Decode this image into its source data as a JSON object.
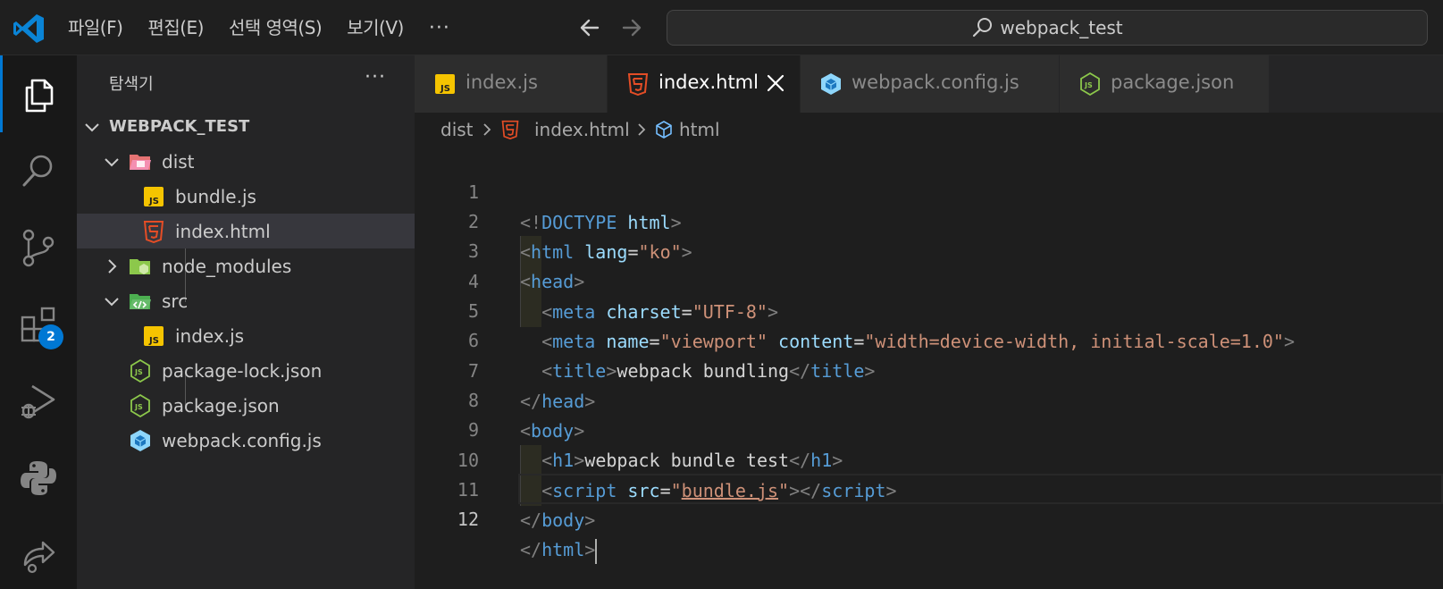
{
  "menu": {
    "items": [
      "파일(F)",
      "편집(E)",
      "선택 영역(S)",
      "보기(V)"
    ],
    "more": "···"
  },
  "search": {
    "text": "webpack_test"
  },
  "activity": {
    "extensions_badge": "2"
  },
  "sidebar": {
    "title": "탐색기",
    "more": "···",
    "root": "WEBPACK_TEST",
    "items": [
      {
        "label": "dist"
      },
      {
        "label": "bundle.js"
      },
      {
        "label": "index.html"
      },
      {
        "label": "node_modules"
      },
      {
        "label": "src"
      },
      {
        "label": "index.js"
      },
      {
        "label": "package-lock.json"
      },
      {
        "label": "package.json"
      },
      {
        "label": "webpack.config.js"
      }
    ]
  },
  "tabs": [
    {
      "label": "index.js"
    },
    {
      "label": "index.html"
    },
    {
      "label": "webpack.config.js"
    },
    {
      "label": "package.json"
    }
  ],
  "breadcrumb": {
    "folder": "dist",
    "file": "index.html",
    "symbol": "html"
  },
  "editor": {
    "line_numbers": [
      "1",
      "2",
      "3",
      "4",
      "5",
      "6",
      "7",
      "8",
      "9",
      "10",
      "11",
      "12"
    ],
    "code": {
      "l1": {
        "p1": "<!",
        "tag": "DOCTYPE",
        "attr": " html",
        "p2": ">"
      },
      "l2": {
        "p1": "<",
        "tag": "html",
        "attr": " lang",
        "eq": "=",
        "str": "\"ko\"",
        "p2": ">"
      },
      "l3": {
        "p1": "<",
        "tag": "head",
        "p2": ">"
      },
      "l4": {
        "p1": "<",
        "tag": "meta",
        "attr": " charset",
        "eq": "=",
        "str": "\"UTF-8\"",
        "p2": ">"
      },
      "l5": {
        "p1": "<",
        "tag": "meta",
        "attr1": " name",
        "eq1": "=",
        "str1": "\"viewport\"",
        "attr2": " content",
        "eq2": "=",
        "str2": "\"width=device-width, initial-scale=1.0\"",
        "p2": ">"
      },
      "l6": {
        "p1": "<",
        "tag": "title",
        "p2": ">",
        "text": "webpack bundling",
        "p3": "</",
        "tag2": "title",
        "p4": ">"
      },
      "l7": {
        "p1": "</",
        "tag": "head",
        "p2": ">"
      },
      "l8": {
        "p1": "<",
        "tag": "body",
        "p2": ">"
      },
      "l9": {
        "p1": "<",
        "tag": "h1",
        "p2": ">",
        "text": "webpack bundle test",
        "p3": "</",
        "tag2": "h1",
        "p4": ">"
      },
      "l10": {
        "p1": "<",
        "tag": "script",
        "attr": " src",
        "eq": "=",
        "q1": "\"",
        "link": "bundle.js",
        "q2": "\"",
        "p2": "></",
        "tag2": "script",
        "p3": ">"
      },
      "l11": {
        "p1": "</",
        "tag": "body",
        "p2": ">"
      },
      "l12": {
        "p1": "</",
        "tag": "html",
        "p2": ">"
      }
    }
  },
  "colors": {
    "accent": "#0078d4",
    "js_yellow": "#f5c400",
    "html_orange": "#e44d26",
    "webpack_blue": "#8ed6fb",
    "node_green": "#8cc84b"
  }
}
